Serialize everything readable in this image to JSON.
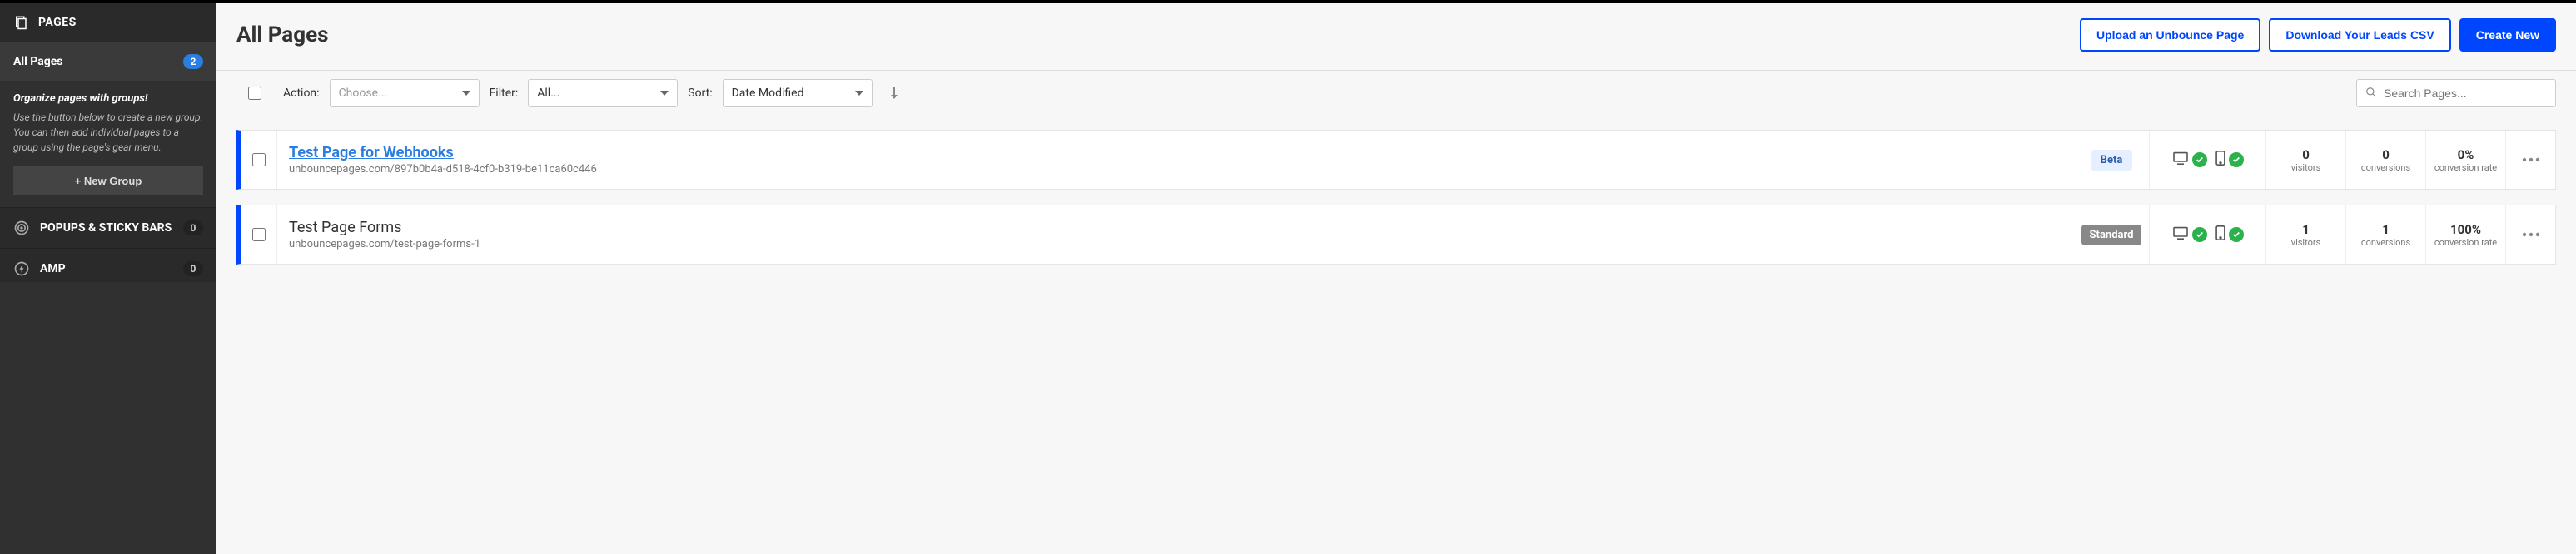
{
  "sidebar": {
    "header_title": "PAGES",
    "all_pages": {
      "label": "All Pages",
      "count": "2"
    },
    "groups": {
      "title": "Organize pages with groups!",
      "desc": "Use the button below to create a new group. You can then add individual pages to a group using the page's gear menu.",
      "button": "+ New Group"
    },
    "popups": {
      "label": "POPUPS & STICKY BARS",
      "count": "0"
    },
    "amp": {
      "label": "AMP",
      "count": "0"
    }
  },
  "header": {
    "title": "All Pages",
    "upload": "Upload an Unbounce Page",
    "download": "Download Your Leads CSV",
    "create": "Create New"
  },
  "toolbar": {
    "action_label": "Action:",
    "action_placeholder": "Choose...",
    "filter_label": "Filter:",
    "filter_value": "All...",
    "sort_label": "Sort:",
    "sort_value": "Date Modified",
    "search_placeholder": "Search Pages..."
  },
  "pages": [
    {
      "title": "Test Page for Webhooks",
      "url": "unbouncepages.com/897b0b4a-d518-4cf0-b319-be11ca60c446",
      "tag": "Beta",
      "visitors": "0",
      "conversions": "0",
      "rate": "0%"
    },
    {
      "title": "Test Page Forms",
      "url": "unbouncepages.com/test-page-forms-1",
      "tag": "Standard",
      "visitors": "1",
      "conversions": "1",
      "rate": "100%"
    }
  ],
  "stat_labels": {
    "visitors": "visitors",
    "conversions": "conversions",
    "rate": "conversion rate"
  }
}
